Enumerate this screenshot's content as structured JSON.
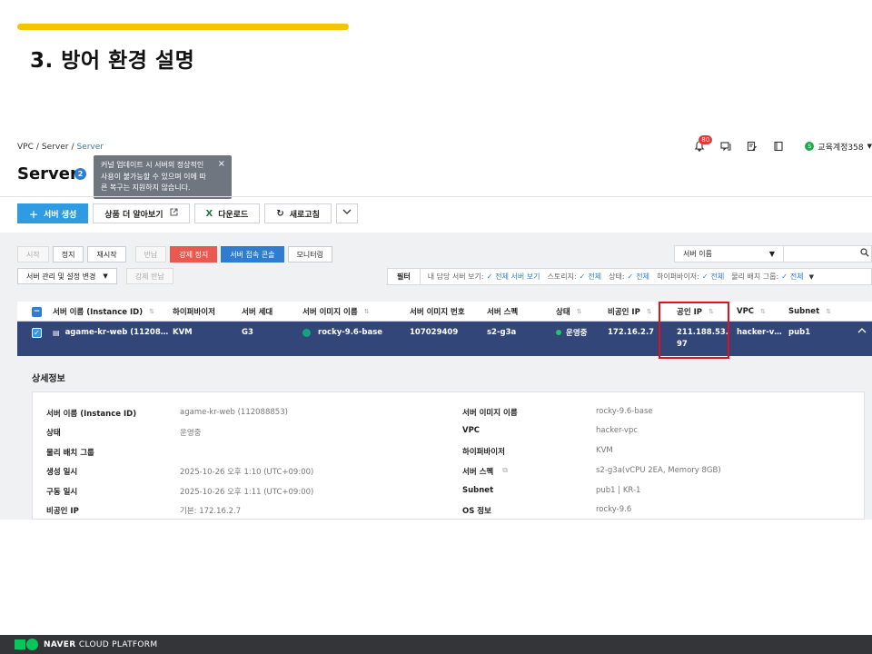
{
  "slide": {
    "title": "3. 방어 환경 설명"
  },
  "breadcrumb": {
    "items": [
      "VPC",
      "Server"
    ],
    "current": "Server",
    "sep": "/"
  },
  "header": {
    "notification_count": "80",
    "account_dot": "S",
    "account_name": "교육계정358"
  },
  "page": {
    "title": "Server",
    "help_count": "2"
  },
  "tooltip": {
    "text": "커널 업데이트 시 서버의 정상적인 사용이 불가능할 수 있으며 이에 따른 복구는 지원하지 않습니다.",
    "close": "×"
  },
  "toolbar": {
    "create": "서버 생성",
    "learn_more": "상품 더 알아보기",
    "download": "다운로드",
    "refresh": "새로고침"
  },
  "actions": {
    "start": "시작",
    "stop": "정지",
    "restart": "재시작",
    "return": "반납",
    "force_stop": "강제 정지",
    "console": "서버 접속 콘솔",
    "monitoring": "모니터링",
    "manage": "서버 관리 및 설정 변경",
    "force_return": "강제 반납"
  },
  "search": {
    "select": "서버 이름"
  },
  "filter": {
    "label": "필터",
    "items": [
      {
        "key": "내 담당 서버 보기:",
        "value": "전체 서버 보기"
      },
      {
        "key": "스토리지:",
        "value": "전체"
      },
      {
        "key": "상태:",
        "value": "전체"
      },
      {
        "key": "하이퍼바이저:",
        "value": "전체"
      },
      {
        "key": "물리 배치 그룹:",
        "value": "전체"
      }
    ]
  },
  "table": {
    "headers": {
      "name": "서버 이름 (Instance ID)",
      "hypervisor": "하이퍼바이저",
      "generation": "서버 세대",
      "image_name": "서버 이미지 이름",
      "image_no": "서버 이미지 번호",
      "spec": "서버 스펙",
      "status": "상태",
      "private_ip": "비공인 IP",
      "public_ip": "공인 IP",
      "vpc": "VPC",
      "subnet": "Subnet"
    },
    "row": {
      "name": "agame-kr-web (11208…",
      "hypervisor": "KVM",
      "generation": "G3",
      "image_name": "rocky-9.6-base",
      "image_no": "107029409",
      "spec": "s2-g3a",
      "status": "운영중",
      "private_ip": "172.16.2.7",
      "public_ip_line1": "211.188.53.",
      "public_ip_line2": "97",
      "vpc": "hacker-v…",
      "subnet": "pub1"
    }
  },
  "detail": {
    "title": "상세정보",
    "left": [
      {
        "label": "서버 이름 (Instance ID)",
        "value": "agame-kr-web (112088853)"
      },
      {
        "label": "상태",
        "value": "운영중"
      },
      {
        "label": "물리 배치 그룹",
        "value": ""
      },
      {
        "label": "생성 일시",
        "value": "2025-10-26 오후 1:10 (UTC+09:00)"
      },
      {
        "label": "구동 일시",
        "value": "2025-10-26 오후 1:11 (UTC+09:00)"
      },
      {
        "label": "비공인 IP",
        "value": "기본: 172.16.2.7"
      }
    ],
    "right": [
      {
        "label": "서버 이미지 이름",
        "value": "rocky-9.6-base"
      },
      {
        "label": "VPC",
        "value": "hacker-vpc"
      },
      {
        "label": "하이퍼바이저",
        "value": "KVM"
      },
      {
        "label": "서버 스펙",
        "value": "s2-g3a(vCPU 2EA, Memory 8GB)"
      },
      {
        "label": "Subnet",
        "value": "pub1 | KR-1"
      },
      {
        "label": "OS 정보",
        "value": "rocky-9.6"
      }
    ]
  },
  "footer": {
    "brand_bold": "NAVER",
    "brand_rest": "CLOUD PLATFORM"
  },
  "colors": {
    "accent": "#2e7dd1",
    "selected_row": "#32467a",
    "highlight_box": "#e0111b",
    "footer_bg": "#333538",
    "brand_green": "#03c75a"
  }
}
